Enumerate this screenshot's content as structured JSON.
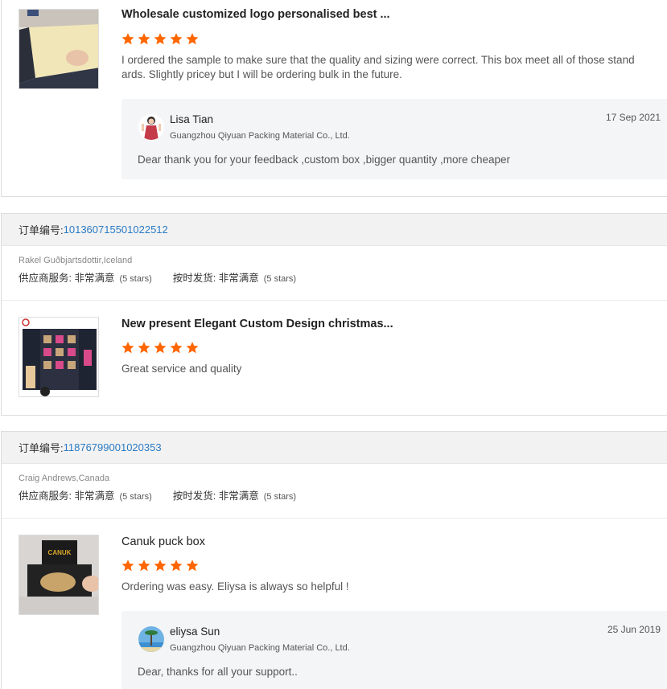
{
  "reviews": [
    {
      "title": "Wholesale customized logo personalised best ...",
      "stars": 5,
      "comment": "I ordered the sample to make sure that the quality and sizing were correct. This box meet all of those stand ards. Slightly pricey but I will be ordering bulk in the future.",
      "reply": {
        "name": "Lisa Tian",
        "company": "Guangzhou Qiyuan Packing Material Co., Ltd.",
        "date": "17 Sep 2021",
        "message": "Dear  thank you for your feedback ,custom box ,bigger quantity ,more cheaper"
      }
    },
    {
      "order_label": "订单编号: ",
      "order_number": "101360715501022512",
      "buyer": "Rakel Guðbjartsdottir,Iceland",
      "supplier_service_label": "供应商服务: 非常满意",
      "supplier_service_stars": "(5 stars)",
      "ontime_label": "按时发货: 非常满意",
      "ontime_stars": "(5 stars)",
      "title": "New present Elegant Custom Design christmas...",
      "stars": 5,
      "comment": "Great service and quality"
    },
    {
      "order_label": "订单编号: ",
      "order_number": "11876799001020353",
      "buyer": "Craig Andrews,Canada",
      "supplier_service_label": "供应商服务: 非常满意",
      "supplier_service_stars": "(5 stars)",
      "ontime_label": "按时发货: 非常满意",
      "ontime_stars": "(5 stars)",
      "title": "Canuk puck box",
      "stars": 5,
      "comment": "Ordering was easy. Eliysa is always so helpful !",
      "reply": {
        "name": "eliysa Sun",
        "company": "Guangzhou Qiyuan Packing Material Co., Ltd.",
        "date": "25 Jun 2019",
        "message": "Dear, thanks for all your support.."
      }
    }
  ],
  "colors": {
    "star": "#ff6600",
    "order_link": "#2b7bc4",
    "header_bg": "#f2f2f2",
    "reply_bg": "#f4f5f7"
  },
  "icons": [
    "star-icon",
    "product-thumbnail",
    "avatar"
  ]
}
